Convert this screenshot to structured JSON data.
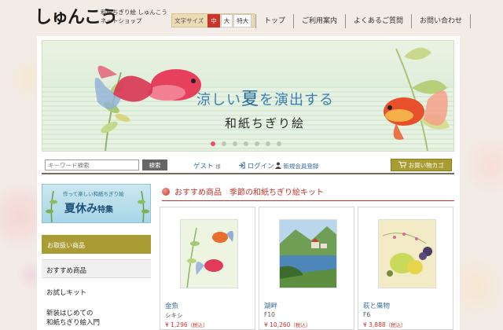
{
  "header": {
    "logo": "しゅんこう",
    "tagline_1": "和紙ちぎり絵 しゅんこう",
    "tagline_2": "ネットショップ",
    "fontsize_label": "文字サイズ",
    "fontsize_options": [
      "中",
      "大",
      "特大"
    ],
    "nav": [
      "トップ",
      "ご利用案内",
      "よくあるご質問",
      "お問い合わせ"
    ]
  },
  "banner": {
    "title_1": "涼しい",
    "title_big": "夏",
    "title_2": "を演出する",
    "subtitle": "和紙ちぎり絵",
    "slide_count": 7,
    "active_slide": 1
  },
  "searchbar": {
    "placeholder": "キーワード検索",
    "search_label": "検索",
    "guest": "ゲスト",
    "guest_suffix": "様",
    "login": "ログイン",
    "register": "新規会員登録",
    "cart": "お買い物カゴ"
  },
  "sidebar": {
    "summer_small": "作って楽しい和紙ちぎり絵",
    "summer_big": "夏休み",
    "summer_suffix": "特集",
    "heading": "お取扱い商品",
    "items": [
      "おすすめ商品",
      "お試しキット",
      "新装はじめての",
      "和紙ちぎり絵入門"
    ]
  },
  "recommended": {
    "title": "おすすめ商品　季節の和紙ちぎり絵キット",
    "products": [
      {
        "name": "金魚",
        "sub": "シキシ",
        "price": "¥ 1,296",
        "tax": "（税込）"
      },
      {
        "name": "湖畔",
        "sub": "F10",
        "price": "¥ 10,260",
        "tax": "（税込）"
      },
      {
        "name": "萩と果物",
        "sub": "F6",
        "price": "¥ 3,888",
        "tax": "（税込）"
      }
    ]
  },
  "colors": {
    "accent": "#c9352a",
    "olive": "#a99c32",
    "link": "#3b6fa8"
  }
}
